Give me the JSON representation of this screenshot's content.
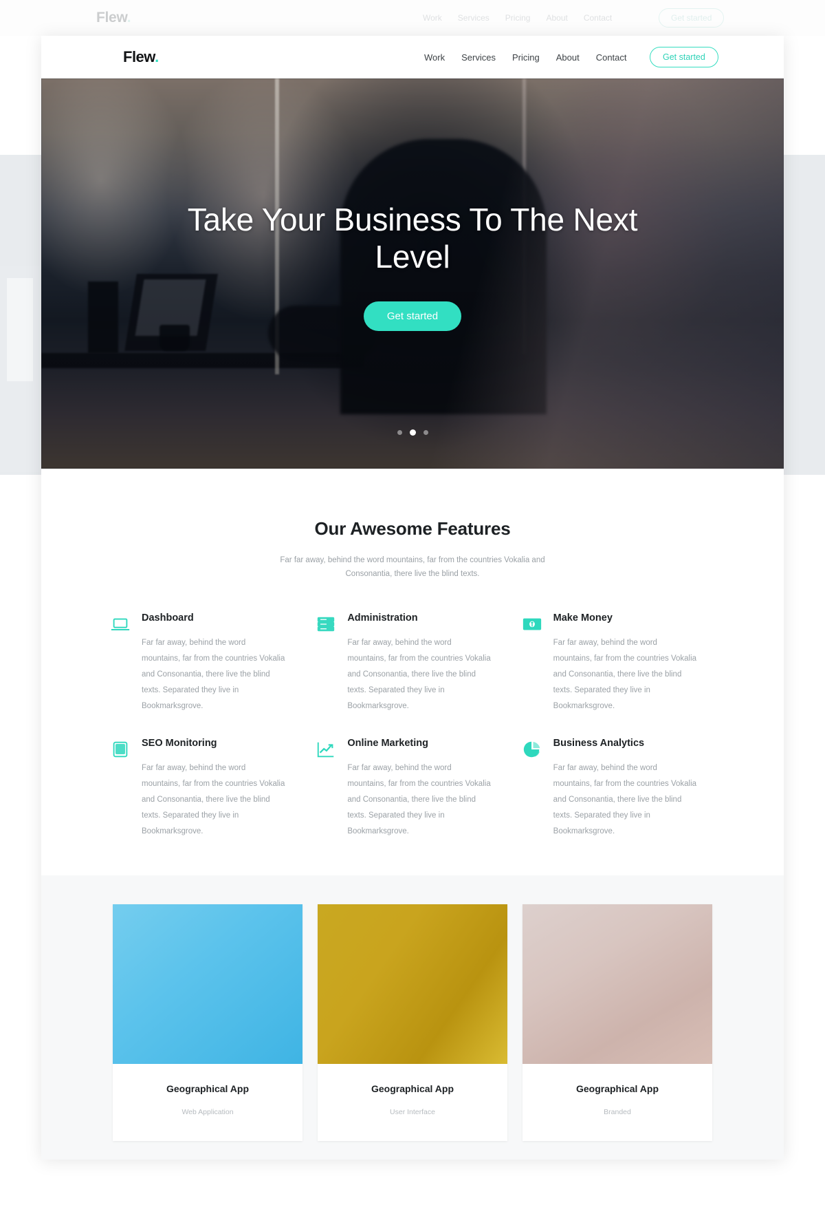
{
  "background": {
    "logo_text": "Flew",
    "logo_dot": ".",
    "nav_items": [
      "Work",
      "Services",
      "Pricing",
      "About",
      "Contact"
    ],
    "cta_label": "Get started"
  },
  "navbar": {
    "logo_text": "Flew",
    "logo_dot": ".",
    "items": [
      {
        "label": "Work"
      },
      {
        "label": "Services"
      },
      {
        "label": "Pricing"
      },
      {
        "label": "About"
      },
      {
        "label": "Contact"
      }
    ],
    "cta_label": "Get started"
  },
  "hero": {
    "title": "Take Your Business To The Next Level",
    "cta_label": "Get started",
    "slider": {
      "count": 3,
      "active_index": 1
    }
  },
  "features": {
    "title": "Our Awesome Features",
    "subtitle": "Far far away, behind the word mountains, far from the countries Vokalia and Consonantia, there live the blind texts.",
    "items": [
      {
        "icon": "laptop-icon",
        "title": "Dashboard",
        "text": "Far far away, behind the word mountains, far from the countries Vokalia and Consonantia, there live the blind texts. Separated they live in Bookmarksgrove."
      },
      {
        "icon": "server-icon",
        "title": "Administration",
        "text": "Far far away, behind the word mountains, far from the countries Vokalia and Consonantia, there live the blind texts. Separated they live in Bookmarksgrove."
      },
      {
        "icon": "banknote-icon",
        "title": "Make Money",
        "text": "Far far away, behind the word mountains, far from the countries Vokalia and Consonantia, there live the blind texts. Separated they live in Bookmarksgrove."
      },
      {
        "icon": "tablet-icon",
        "title": "SEO Monitoring",
        "text": "Far far away, behind the word mountains, far from the countries Vokalia and Consonantia, there live the blind texts. Separated they live in Bookmarksgrove."
      },
      {
        "icon": "line-chart-icon",
        "title": "Online Marketing",
        "text": "Far far away, behind the word mountains, far from the countries Vokalia and Consonantia, there live the blind texts. Separated they live in Bookmarksgrove."
      },
      {
        "icon": "pie-chart-icon",
        "title": "Business Analytics",
        "text": "Far far away, behind the word mountains, far from the countries Vokalia and Consonantia, there live the blind texts. Separated they live in Bookmarksgrove."
      }
    ]
  },
  "portfolio": {
    "items": [
      {
        "title": "Geographical App",
        "category": "Web Application",
        "thumb": "blue"
      },
      {
        "title": "Geographical App",
        "category": "User Interface",
        "thumb": "gold"
      },
      {
        "title": "Geographical App",
        "category": "Branded",
        "thumb": "rose"
      }
    ]
  },
  "colors": {
    "accent": "#32dfc2",
    "heading": "#1d2124",
    "body_text": "#9ba1a6",
    "portfolio_bg": "#f7f8f9"
  }
}
